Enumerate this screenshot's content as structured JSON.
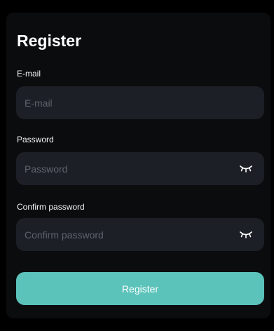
{
  "register_form": {
    "title": "Register",
    "email": {
      "label": "E-mail",
      "placeholder": "E-mail"
    },
    "password": {
      "label": "Password",
      "placeholder": "Password",
      "toggle_icon": "eye-closed-icon"
    },
    "confirm_password": {
      "label": "Confirm password",
      "placeholder": "Confirm password",
      "toggle_icon": "eye-closed-icon"
    },
    "submit_label": "Register"
  },
  "colors": {
    "background": "#000000",
    "card": "#0b0c0e",
    "input_background": "#1c1f26",
    "placeholder": "#5f636b",
    "accent": "#5cc3bb",
    "text": "#ffffff"
  }
}
